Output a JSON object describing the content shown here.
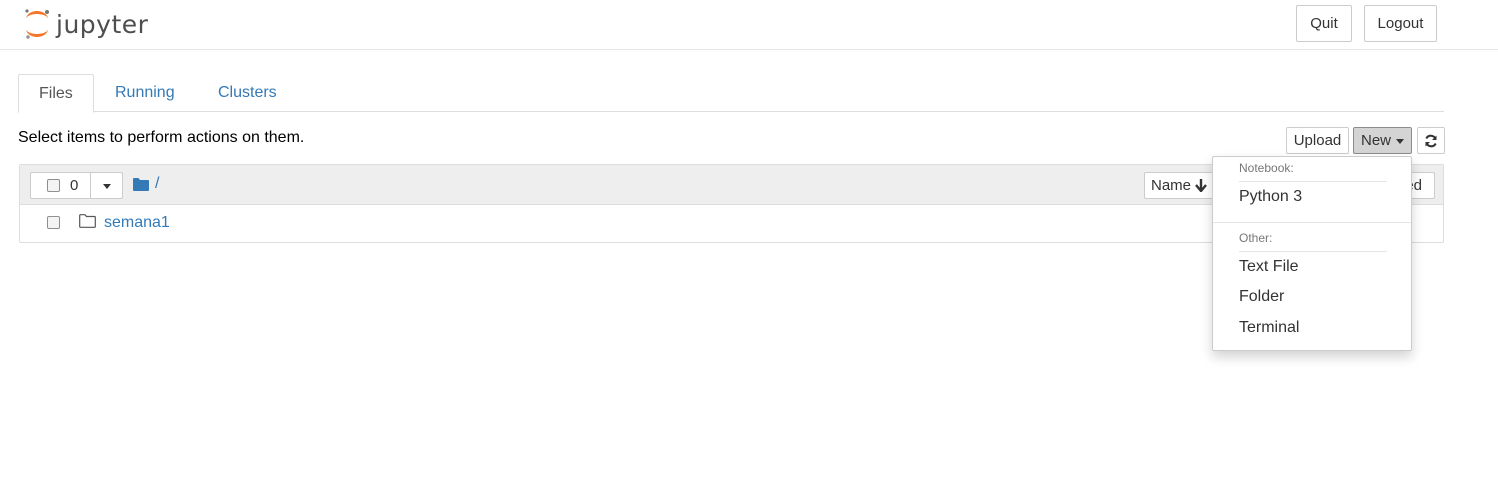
{
  "header": {
    "logo_text": "jupyter",
    "quit_label": "Quit",
    "logout_label": "Logout"
  },
  "tabs": [
    {
      "label": "Files",
      "active": true
    },
    {
      "label": "Running",
      "active": false
    },
    {
      "label": "Clusters",
      "active": false
    }
  ],
  "toolbar": {
    "instruction": "Select items to perform actions on them.",
    "upload_label": "Upload",
    "new_label": "New"
  },
  "list": {
    "selected_count": "0",
    "breadcrumb_path": "/",
    "name_sort_label": "Name",
    "date_sort_label": "Last Modified",
    "items": [
      {
        "name": "semana1",
        "type": "folder"
      }
    ]
  },
  "new_menu": {
    "notebook_header": "Notebook:",
    "notebook_items": [
      "Python 3"
    ],
    "other_header": "Other:",
    "other_items": [
      "Text File",
      "Folder",
      "Terminal"
    ]
  },
  "colors": {
    "link": "#337ab7",
    "logo_orange": "#f37726"
  },
  "icons": {
    "refresh": "refresh-icon",
    "folder": "folder-icon",
    "sort": "arrow-down-icon"
  }
}
